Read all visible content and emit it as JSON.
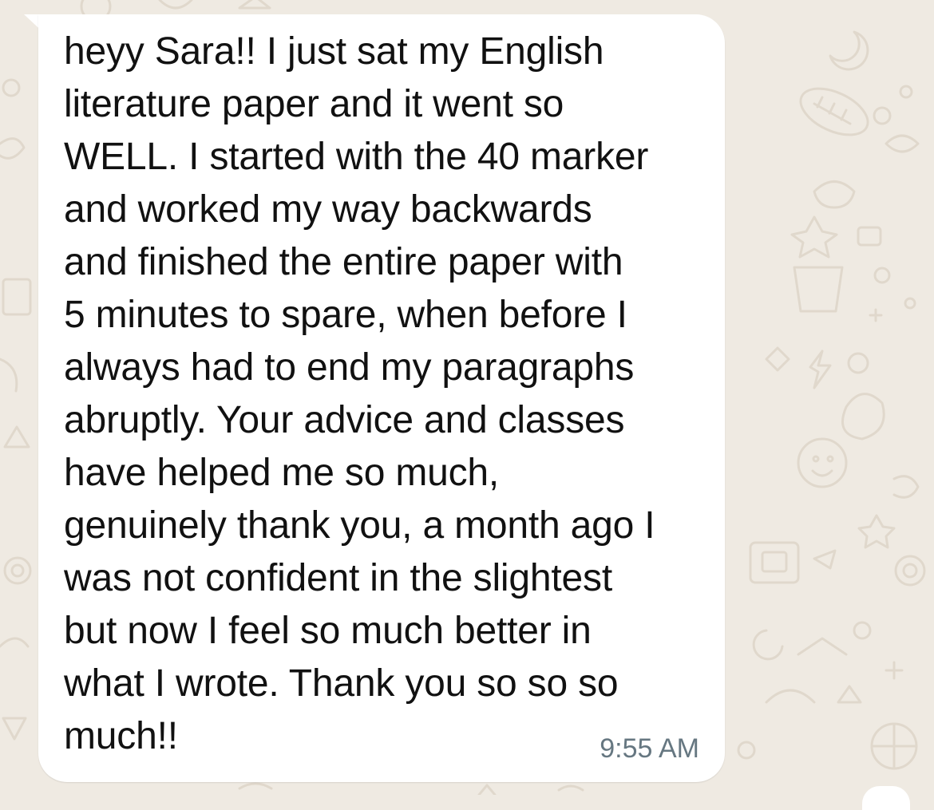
{
  "chat": {
    "background_color": "#efeae2",
    "wallpaper_doodle_color": "#e0d8cc",
    "message": {
      "direction": "incoming",
      "bubble_color": "#ffffff",
      "text": "heyy Sara!! I just sat my English\nliterature paper and it went so\nWELL. I started with the 40 marker\nand worked my way backwards\nand finished the entire paper with\n5 minutes to spare, when before I\nalways had to end my paragraphs\nabruptly. Your advice and classes\nhave helped me so much,\ngenuinely thank you, a month ago I\nwas not confident in the slightest\nbut now I feel so much better in\nwhat I wrote. Thank you so so so\nmuch!!",
      "time": "9:55 AM",
      "time_color": "#667781"
    }
  }
}
